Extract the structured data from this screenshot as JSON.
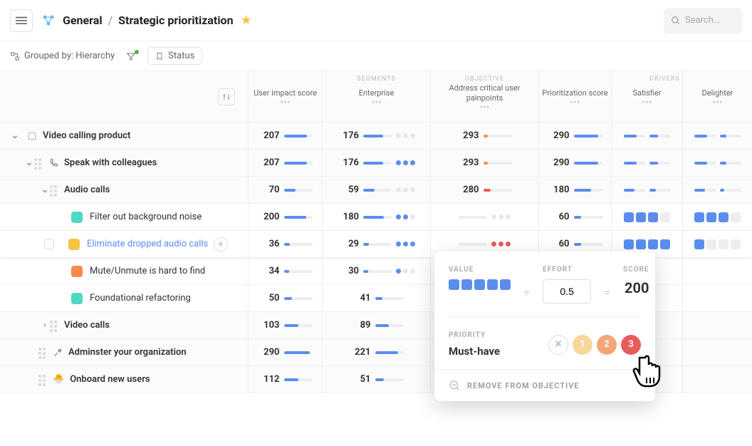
{
  "breadcrumb": {
    "root": "General",
    "page": "Strategic prioritization"
  },
  "search": {
    "placeholder": "Search..."
  },
  "subbar": {
    "grouped_label": "Grouped by: Hierarchy",
    "status_label": "Status"
  },
  "columns": {
    "impact": "User impact score",
    "enterprise": "Enterprise",
    "objective": "Address critical user painpoints",
    "prior": "Prioritization score",
    "satisfier": "Satisfier",
    "delighter": "Delighter",
    "group_segments": "SEGMENTS",
    "group_objective": "OBJECTIVE",
    "group_drivers": "DRIVERS"
  },
  "rows": [
    {
      "name": "Video calling product",
      "impact": "207",
      "enterprise": "176",
      "objective": "293",
      "prior": "290"
    },
    {
      "name": "Speak with colleagues",
      "impact": "207",
      "enterprise": "176",
      "objective": "293",
      "prior": "290"
    },
    {
      "name": "Audio calls",
      "impact": "70",
      "enterprise": "59",
      "objective": "280",
      "prior": "180"
    },
    {
      "name": "Filter out background noise",
      "impact": "200",
      "enterprise": "180",
      "objective": "",
      "prior": "60"
    },
    {
      "name": "Eliminate dropped audio calls",
      "impact": "36",
      "enterprise": "29",
      "objective": "",
      "prior": "60"
    },
    {
      "name": "Mute/Unmute is hard to find",
      "impact": "34",
      "enterprise": "30",
      "objective": "",
      "prior": ""
    },
    {
      "name": "Foundational refactoring",
      "impact": "50",
      "enterprise": "41",
      "objective": "",
      "prior": ""
    },
    {
      "name": "Video calls",
      "impact": "103",
      "enterprise": "89",
      "objective": "",
      "prior": ""
    },
    {
      "name": "Adminster your organization",
      "impact": "290",
      "enterprise": "221",
      "objective": "",
      "prior": ""
    },
    {
      "name": "Onboard new users",
      "impact": "112",
      "enterprise": "51",
      "objective": "",
      "prior": ""
    }
  ],
  "popup": {
    "value_label": "VALUE",
    "effort_label": "EFFORT",
    "score_label": "SCORE",
    "effort_value": "0.5",
    "score_value": "200",
    "priority_label": "PRIORITY",
    "priority_value": "Must-have",
    "p1": "1",
    "p2": "2",
    "p3": "3",
    "remove": "REMOVE FROM OBJECTIVE"
  }
}
